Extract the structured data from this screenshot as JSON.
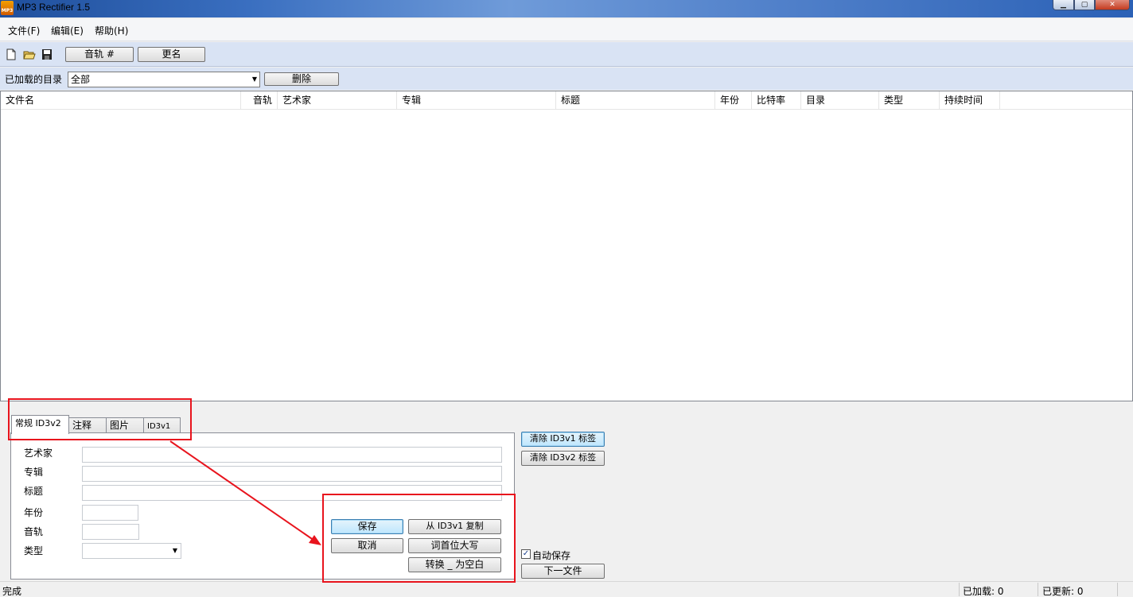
{
  "window": {
    "title": "MP3 Rectifier 1.5",
    "icon_text": "MP3"
  },
  "menu": [
    "文件(F)",
    "编辑(E)",
    "帮助(H)"
  ],
  "toolbar": {
    "icons": [
      "new-file-icon",
      "open-folder-icon",
      "save-disk-icon"
    ],
    "track_button": "音轨 #",
    "rename_button": "更名"
  },
  "dirbar": {
    "label": "已加载的目录",
    "selected": "全部",
    "delete_button": "删除"
  },
  "columns": [
    "文件名",
    "音轨",
    "艺术家",
    "专辑",
    "标题",
    "年份",
    "比特率",
    "目录",
    "类型",
    "持续时间"
  ],
  "tabs": [
    "常规 ID3v2",
    "注释",
    "图片",
    "ID3v1"
  ],
  "form": {
    "artist_label": "艺术家",
    "album_label": "专辑",
    "title_label": "标题",
    "year_label": "年份",
    "track_label": "音轨",
    "genre_label": "类型",
    "artist_value": "",
    "album_value": "",
    "title_value": "",
    "year_value": "",
    "track_value": "",
    "genre_value": ""
  },
  "buttons": {
    "save": "保存",
    "cancel": "取消",
    "copy_from_id3v1": "从 ID3v1 复制",
    "capitalize": "词首位大写",
    "convert_underscore": "转换 _ 为空白",
    "clear_id3v1": "清除 ID3v1 标签",
    "clear_id3v2": "清除 ID3v2 标签",
    "next_file": "下一文件"
  },
  "autosave": {
    "label": "自动保存",
    "checked": true
  },
  "status": {
    "text": "完成",
    "loaded": "已加载: 0",
    "updated": "已更新: 0"
  },
  "colors": {
    "highlight_red": "#e8141d"
  }
}
